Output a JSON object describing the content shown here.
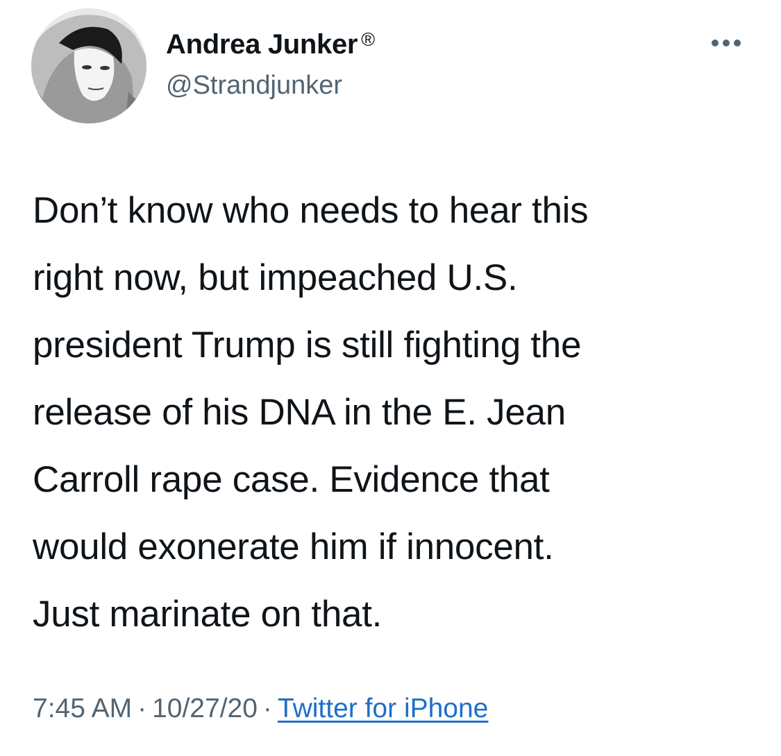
{
  "author": {
    "display_name": "Andrea Junker",
    "verified_mark": "®",
    "handle": "@Strandjunker",
    "avatar_icon": "profile-photo"
  },
  "menu": {
    "more_icon": "more-horizontal-icon"
  },
  "tweet": {
    "lines": [
      "Don’t know who needs to hear this",
      "right now, but impeached U.S.",
      "president Trump is still fighting the",
      "release of his DNA in the E. Jean",
      "Carroll rape case. Evidence that",
      "would exonerate him if innocent.",
      "Just marinate on that."
    ]
  },
  "meta": {
    "time": "7:45 AM",
    "separator": "·",
    "date": "10/27/20",
    "source": "Twitter for iPhone"
  },
  "colors": {
    "text": "#0f1419",
    "secondary": "#536471",
    "link": "#1d6ec9",
    "background": "#ffffff"
  }
}
